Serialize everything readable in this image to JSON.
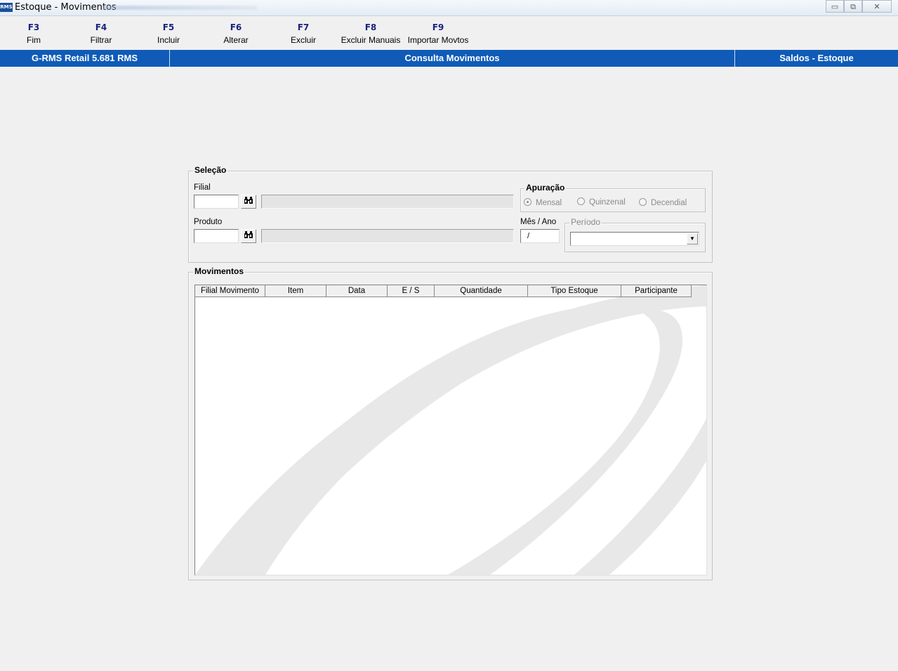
{
  "window": {
    "title": "Estoque - Movimentos",
    "icon_text": "RMS",
    "controls": {
      "minimize": "▭",
      "restore": "⧉",
      "close": "✕"
    }
  },
  "toolbar": {
    "items": [
      {
        "key": "F3",
        "label": "Fim"
      },
      {
        "key": "F4",
        "label": "Filtrar"
      },
      {
        "key": "F5",
        "label": "Incluir"
      },
      {
        "key": "F6",
        "label": "Alterar"
      },
      {
        "key": "F7",
        "label": "Excluir"
      },
      {
        "key": "F8",
        "label": "Excluir Manuais"
      },
      {
        "key": "F9",
        "label": "Importar Movtos"
      }
    ]
  },
  "header_bar": {
    "left": "G-RMS Retail 5.681 RMS",
    "center": "Consulta Movimentos",
    "right": "Saldos - Estoque"
  },
  "selecao": {
    "title": "Seleção",
    "filial_label": "Filial",
    "filial_value": "",
    "produto_label": "Produto",
    "produto_value": "",
    "apuracao": {
      "title": "Apuração",
      "options": [
        "Mensal",
        "Quinzenal",
        "Decendial"
      ],
      "selected": "Mensal"
    },
    "mes_ano_label": "Mês / Ano",
    "mes_ano_value": "/",
    "periodo": {
      "title": "Período",
      "value": ""
    }
  },
  "movimentos": {
    "title": "Movimentos",
    "columns": [
      "Filial Movimento",
      "Item",
      "Data",
      "E / S",
      "Quantidade",
      "Tipo Estoque",
      "Participante"
    ],
    "rows": []
  },
  "icons": {
    "search": "binoculars-icon",
    "dropdown": "chevron-down-icon"
  },
  "colors": {
    "header_bar": "#0f5bb7",
    "toolbar_key": "#1a237e",
    "background": "#f0f0f0"
  }
}
